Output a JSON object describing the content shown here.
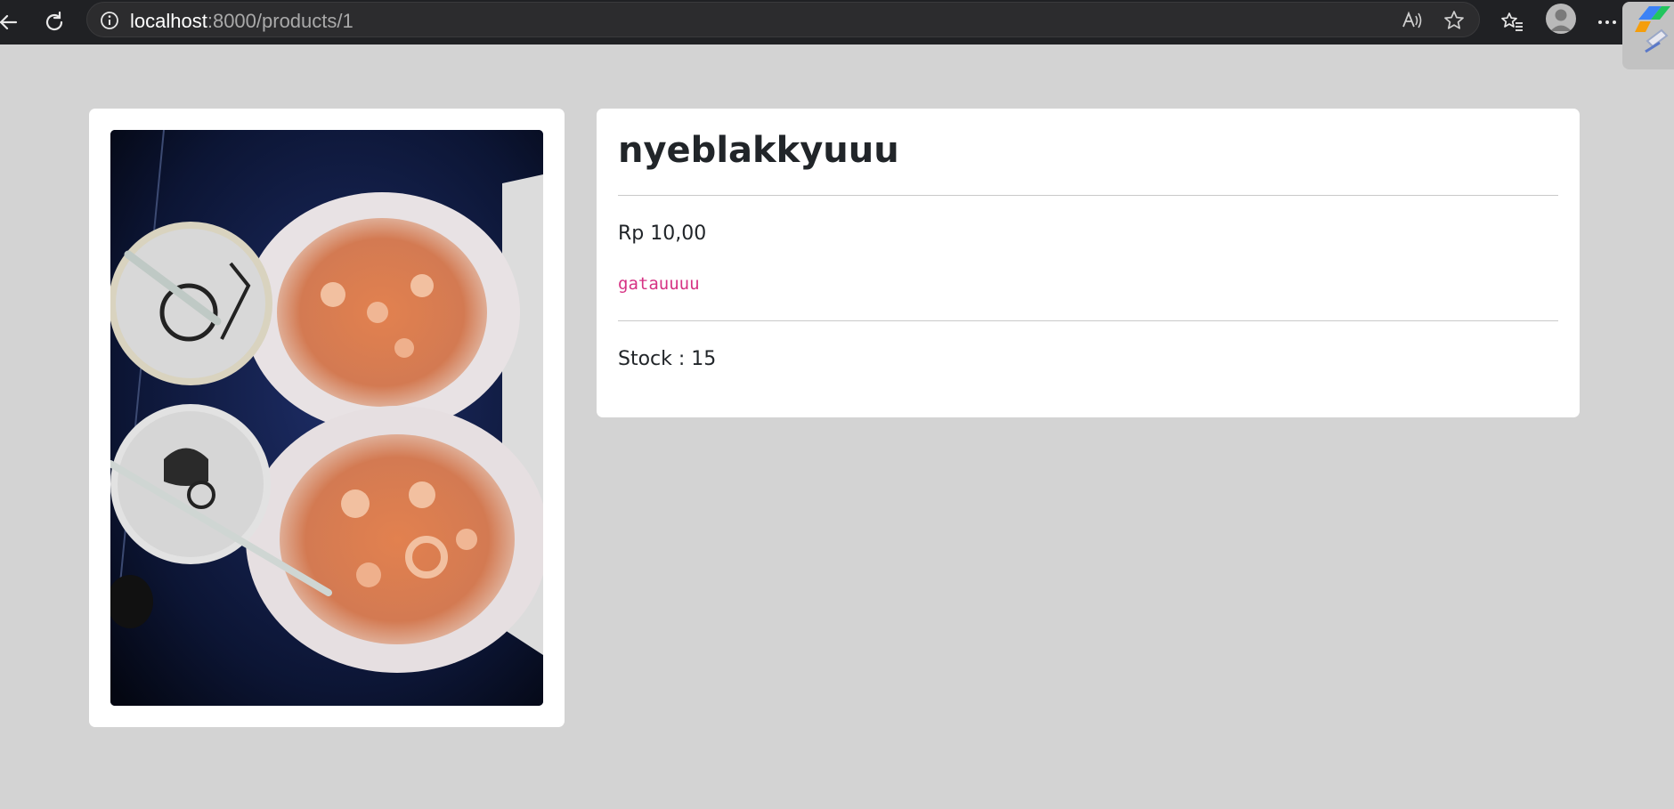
{
  "browser": {
    "url_host": "localhost",
    "url_rest": ":8000/products/1"
  },
  "product": {
    "name": "nyeblakkyuuu",
    "price": "Rp 10,00",
    "description": "gatauuuu",
    "stock": "Stock : 15"
  },
  "icons": {
    "back": "back-arrow-icon",
    "refresh": "refresh-icon",
    "info": "info-icon",
    "read_aloud": "read-aloud-icon",
    "favorite": "star-icon",
    "favorites": "favorites-icon",
    "profile": "profile-icon",
    "more": "more-icon",
    "copilot": "copilot-icon"
  },
  "colors": {
    "page_bg": "#d3d3d3",
    "card_bg": "#ffffff",
    "code_text": "#d63384",
    "chrome_bg": "#202124"
  }
}
